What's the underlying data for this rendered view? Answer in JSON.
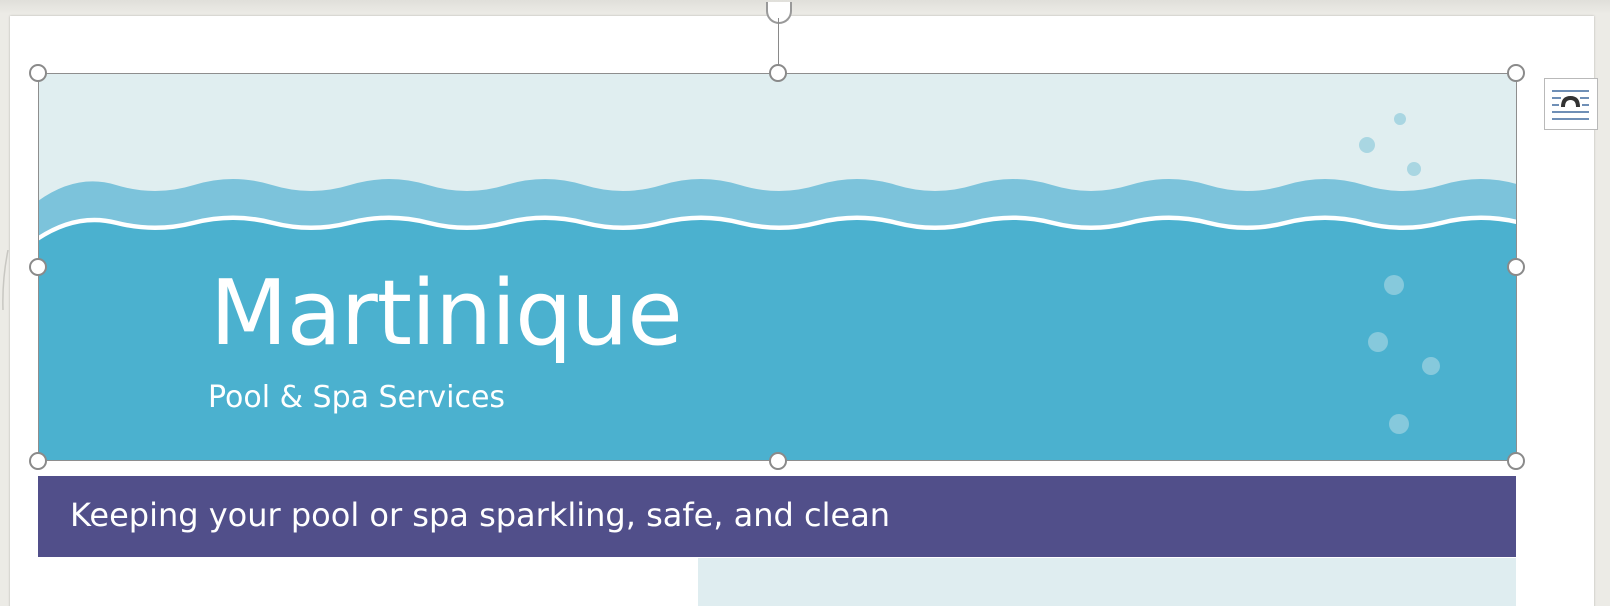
{
  "banner": {
    "title": "Martinique",
    "subtitle": "Pool & Spa Services"
  },
  "tagline": "Keeping your pool or spa sparkling, safe, and clean",
  "layout_options": {
    "icon": "layout-options-icon"
  },
  "colors": {
    "sky": "#e0eef0",
    "water": "#4bb1cf",
    "wave_light": "#7cc3db",
    "tagline_bar": "#514f8a",
    "side_panel": "#dfedf0",
    "bubble": "#86c9dc",
    "handle_border": "#8a8a8a"
  }
}
